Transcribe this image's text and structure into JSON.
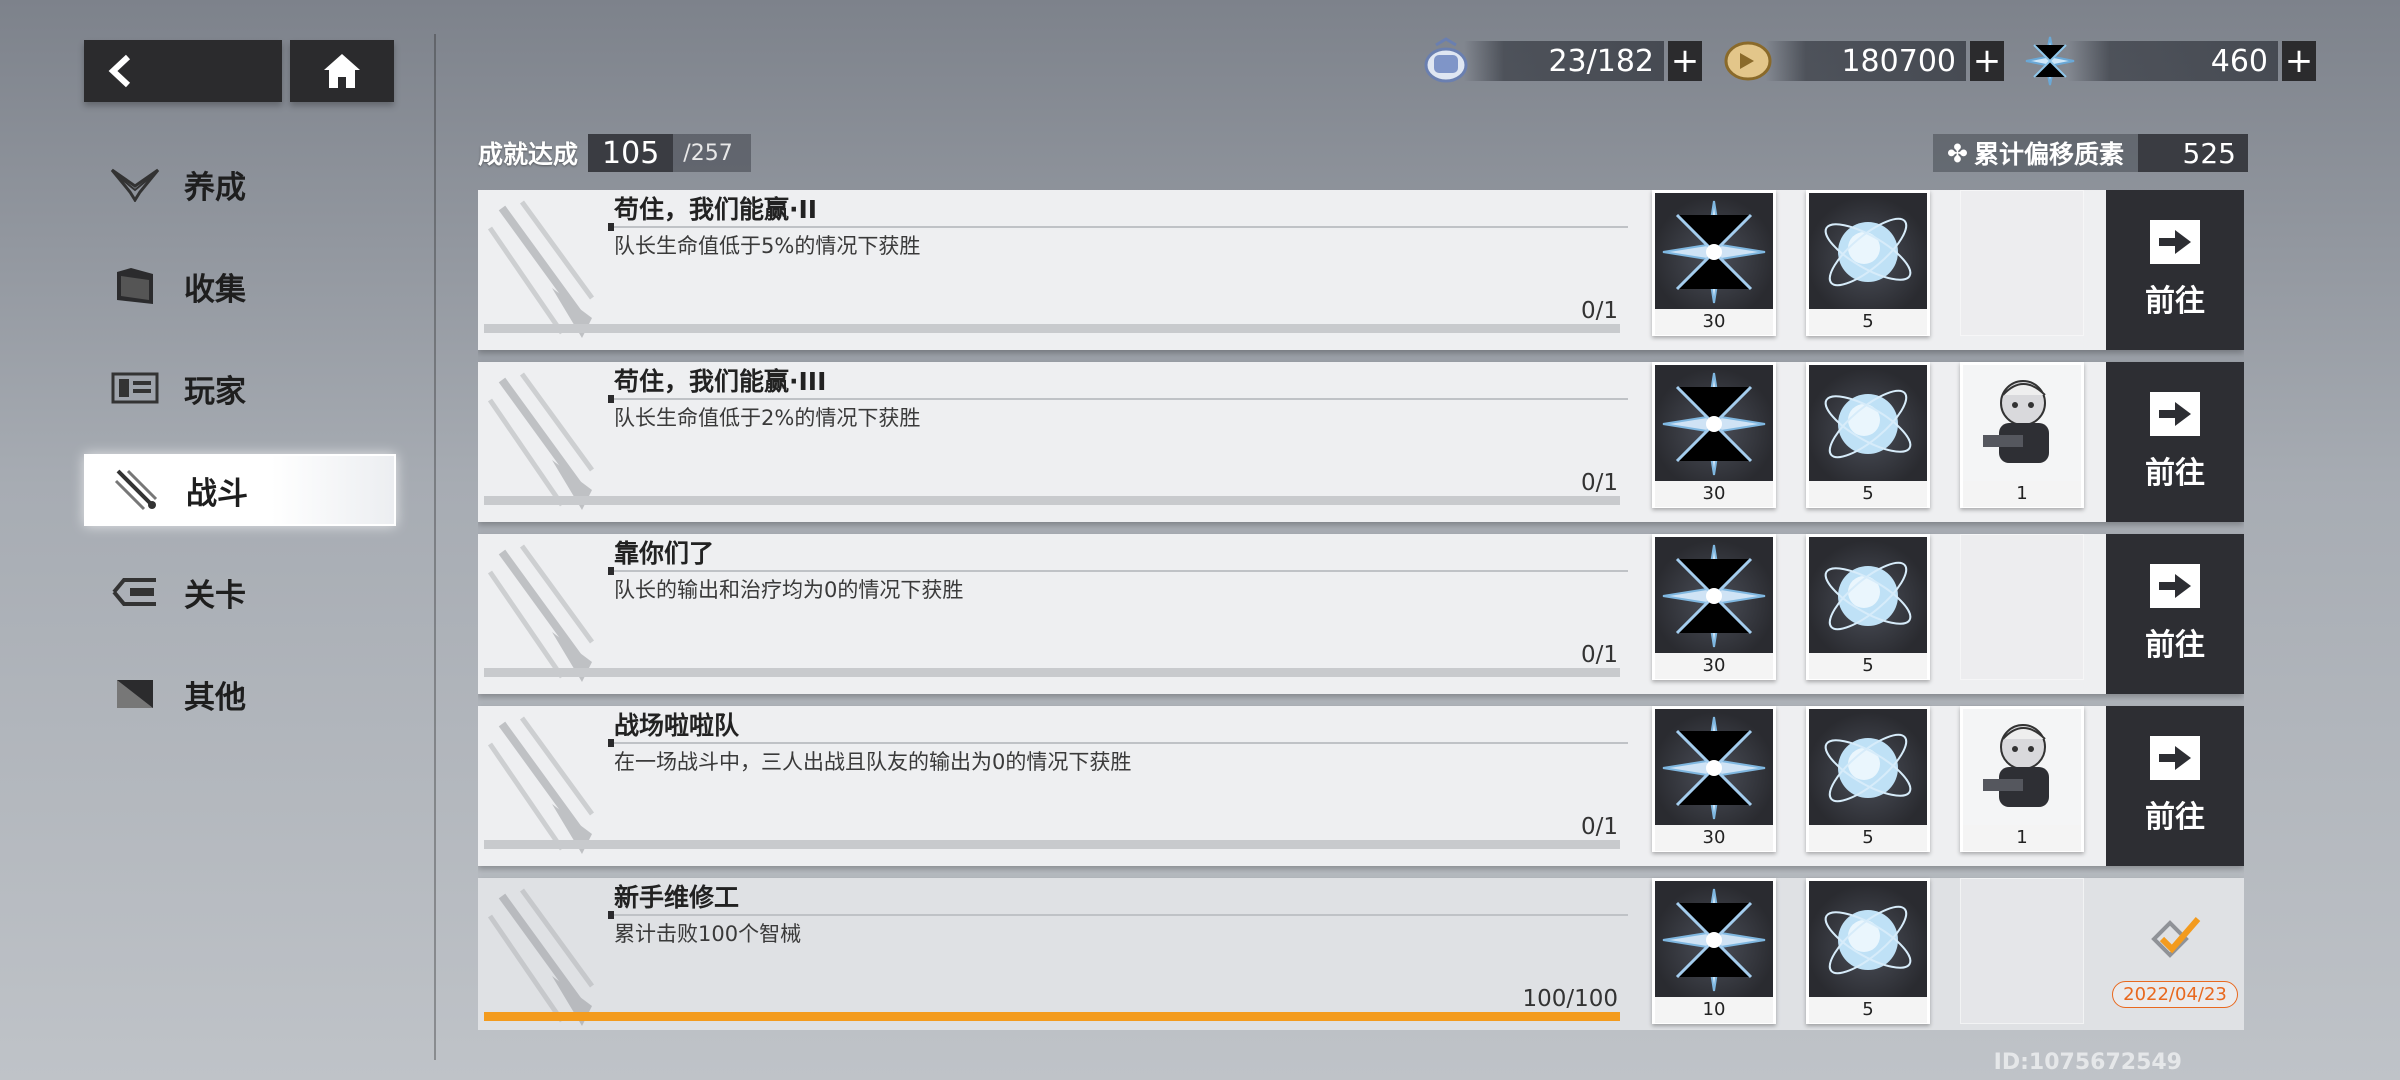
{
  "nav": {
    "back_label": "back",
    "home_label": "home"
  },
  "currencies": [
    {
      "icon": "stamina-icon",
      "value": "23/182"
    },
    {
      "icon": "coin-icon",
      "value": "180700"
    },
    {
      "icon": "crystal-icon",
      "value": "460"
    }
  ],
  "sidebar": {
    "items": [
      {
        "label": "养成",
        "icon": "wings-icon",
        "active": false
      },
      {
        "label": "收集",
        "icon": "folder-icon",
        "active": false
      },
      {
        "label": "玩家",
        "icon": "id-card-icon",
        "active": false
      },
      {
        "label": "战斗",
        "icon": "swords-icon",
        "active": true
      },
      {
        "label": "关卡",
        "icon": "stage-icon",
        "active": false
      },
      {
        "label": "其他",
        "icon": "misc-icon",
        "active": false
      }
    ]
  },
  "summary": {
    "label": "成就达成",
    "current": "105",
    "total": "/257"
  },
  "drift": {
    "label": "累计偏移质素",
    "value": "525"
  },
  "achievements": [
    {
      "title": "苟住，我们能赢·II",
      "desc": "队长生命值低于5%的情况下获胜",
      "progress_text": "0/1",
      "progress": 0,
      "rewards": [
        {
          "type": "crystal",
          "qty": "30"
        },
        {
          "type": "orb",
          "qty": "5"
        },
        {
          "type": "empty",
          "qty": ""
        }
      ],
      "status": "go",
      "go_label": "前往"
    },
    {
      "title": "苟住，我们能赢·III",
      "desc": "队长生命值低于2%的情况下获胜",
      "progress_text": "0/1",
      "progress": 0,
      "rewards": [
        {
          "type": "crystal",
          "qty": "30"
        },
        {
          "type": "orb",
          "qty": "5"
        },
        {
          "type": "char",
          "qty": "1"
        }
      ],
      "status": "go",
      "go_label": "前往"
    },
    {
      "title": "靠你们了",
      "desc": "队长的输出和治疗均为0的情况下获胜",
      "progress_text": "0/1",
      "progress": 0,
      "rewards": [
        {
          "type": "crystal",
          "qty": "30"
        },
        {
          "type": "orb",
          "qty": "5"
        },
        {
          "type": "empty",
          "qty": ""
        }
      ],
      "status": "go",
      "go_label": "前往"
    },
    {
      "title": "战场啦啦队",
      "desc": "在一场战斗中，三人出战且队友的输出为0的情况下获胜",
      "progress_text": "0/1",
      "progress": 0,
      "rewards": [
        {
          "type": "crystal",
          "qty": "30"
        },
        {
          "type": "orb",
          "qty": "5"
        },
        {
          "type": "char",
          "qty": "1"
        }
      ],
      "status": "go",
      "go_label": "前往"
    },
    {
      "title": "新手维修工",
      "desc": "累计击败100个智械",
      "progress_text": "100/100",
      "progress": 1,
      "rewards": [
        {
          "type": "crystal",
          "qty": "10"
        },
        {
          "type": "orb",
          "qty": "5"
        },
        {
          "type": "empty",
          "qty": ""
        }
      ],
      "status": "done",
      "date": "2022/04/23"
    }
  ],
  "player_id": "ID:1075672549",
  "colors": {
    "accent": "#f39b1e",
    "dark": "#2d2e33",
    "done_date": "#e8691f"
  }
}
